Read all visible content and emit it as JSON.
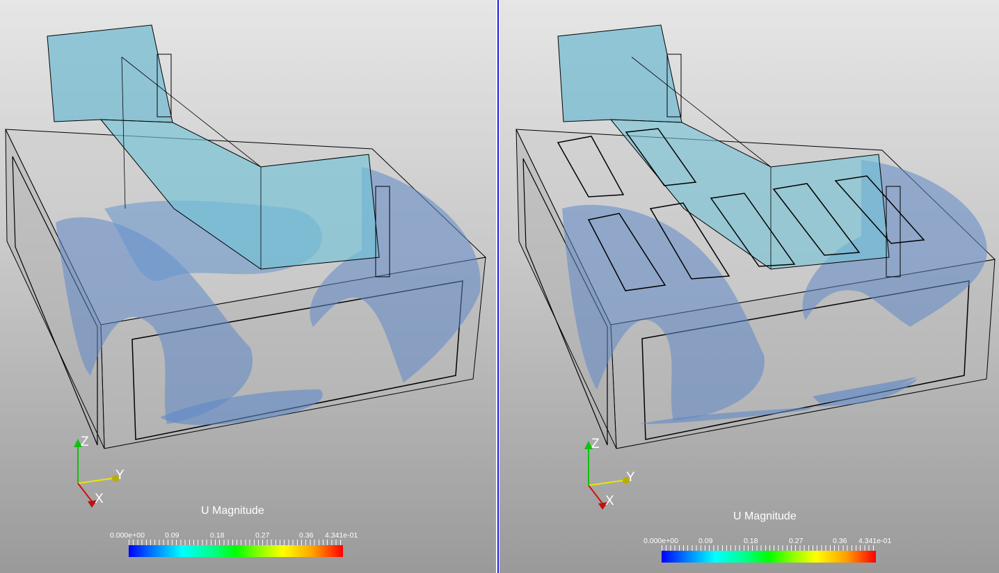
{
  "views": [
    {
      "id": "left",
      "colorbar": {
        "title": "U Magnitude",
        "tick_labels": [
          "0.000e+00",
          "0.09",
          "0.18",
          "0.27",
          "0.36",
          "4.341e-01"
        ],
        "range": [
          0,
          0.4341
        ],
        "colormap": "rainbow-blue-red"
      },
      "axes": {
        "z": "Z",
        "y": "Y",
        "x": "X"
      }
    },
    {
      "id": "right",
      "colorbar": {
        "title": "U Magnitude",
        "tick_labels": [
          "0.000e+00",
          "0.09",
          "0.18",
          "0.27",
          "0.36",
          "4.341e-01"
        ],
        "range": [
          0,
          0.4341
        ],
        "colormap": "rainbow-blue-red"
      },
      "axes": {
        "z": "Z",
        "y": "Y",
        "x": "X"
      }
    }
  ],
  "colors": {
    "iso_blue": "#5f88c8",
    "iso_cyan": "#72c6d2",
    "duct_fill": "#7ab8d0",
    "outline": "#000000",
    "active_view_border": "#1818d8",
    "axis_x": "#d11010",
    "axis_y": "#e8e800",
    "axis_z": "#10c010"
  }
}
